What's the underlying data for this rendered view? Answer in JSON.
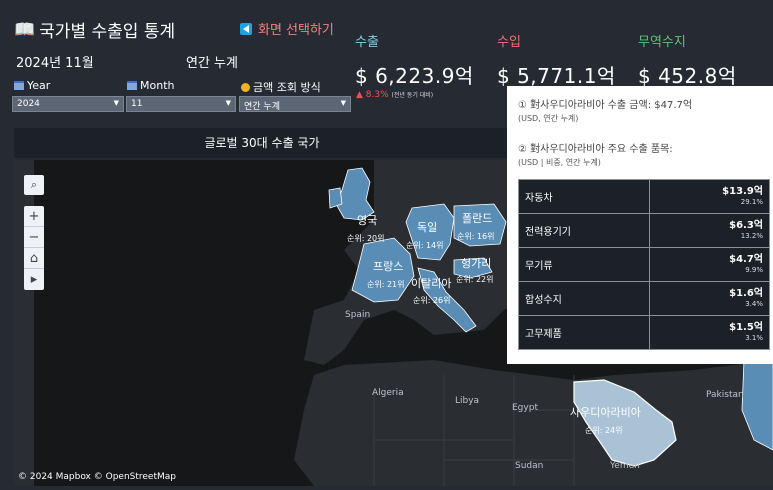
{
  "header": {
    "title": "국가별 수출입 통계",
    "switch_label": "화면 선택하기",
    "period": "2024년 11월",
    "cumulative": "연간 누계"
  },
  "filters": {
    "year_label": "Year",
    "year_value": "2024",
    "month_label": "Month",
    "month_value": "11",
    "method_label": "금액 조회 방식",
    "method_value": "연간 누계"
  },
  "kpis": {
    "export_label": "수출",
    "export_value": "$ 6,223.9억",
    "export_change": "▲ 8.3%",
    "export_change_note": "(전년 동기 대비)",
    "import_label": "수입",
    "import_value": "$ 5,771.1억",
    "balance_label": "무역수지",
    "balance_value": "$ 452.8억"
  },
  "map": {
    "header": "글로벌 30대 수출 국가",
    "attribution": "© 2024 Mapbox © OpenStreetMap",
    "countries": [
      {
        "name": "영국",
        "rank": "순위: 20위"
      },
      {
        "name": "독일",
        "rank": "순위: 14위"
      },
      {
        "name": "폴란드",
        "rank": "순위: 16위"
      },
      {
        "name": "프랑스",
        "rank": "순위: 21위"
      },
      {
        "name": "이탈리아",
        "rank": "순위: 26위"
      },
      {
        "name": "헝가리",
        "rank": "순위: 22위"
      },
      {
        "name": "사우디아라비아",
        "rank": "순위: 24위"
      }
    ],
    "geo_labels": [
      "Spain",
      "Algeria",
      "Libya",
      "Egypt",
      "Sudan",
      "Yemen",
      "Pakistan"
    ],
    "colors": {
      "highlight": "#5a8db5",
      "land": "#2a2d31",
      "sea": "#151719"
    }
  },
  "tooltip": {
    "export_amount": "① 對사우디아라비아 수출 금액: $47.7억",
    "export_amount_note": "(USD,  연간 누계)",
    "items_title": "② 對사우디아라비아 주요 수출 품목:",
    "items_note": "(USD | 비중,  연간 누계)",
    "items": [
      {
        "name": "자동차",
        "value": "$13.9억",
        "share": "29.1%"
      },
      {
        "name": "전력용기기",
        "value": "$6.3억",
        "share": "13.2%"
      },
      {
        "name": "무기류",
        "value": "$4.7억",
        "share": "9.9%"
      },
      {
        "name": "합성수지",
        "value": "$1.6억",
        "share": "3.4%"
      },
      {
        "name": "고무제품",
        "value": "$1.5억",
        "share": "3.1%"
      }
    ]
  }
}
